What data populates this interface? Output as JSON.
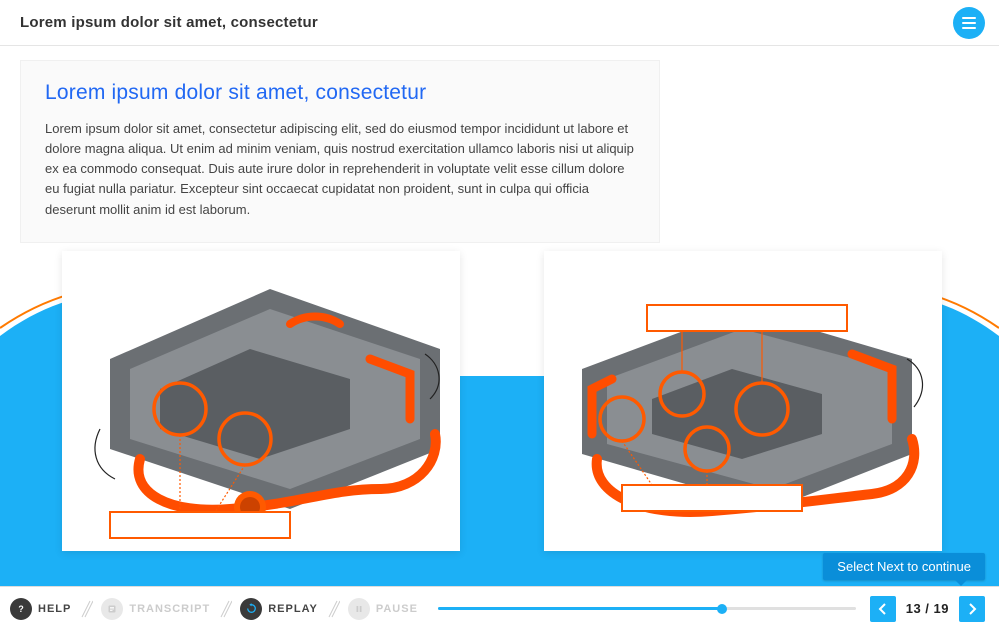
{
  "header": {
    "title": "Lorem ipsum dolor sit amet, consectetur"
  },
  "content": {
    "heading": "Lorem ipsum dolor sit amet, consectetur",
    "body": "Lorem ipsum dolor sit amet, consectetur adipiscing elit, sed do eiusmod tempor incididunt ut labore et dolore magna aliqua. Ut enim ad minim veniam, quis nostrud exercitation ullamco laboris nisi ut aliquip ex ea commodo consequat. Duis aute irure dolor in reprehenderit in voluptate velit esse cillum dolore eu fugiat nulla pariatur. Excepteur sint occaecat cupidatat non proident, sunt in culpa qui officia deserunt mollit anim id est laborum."
  },
  "hint": {
    "text": "Select Next to continue"
  },
  "footer": {
    "help": "HELP",
    "transcript": "TRANSCRIPT",
    "replay": "REPLAY",
    "pause": "PAUSE",
    "page_current": "13",
    "page_sep": " / ",
    "page_total": "19",
    "progress_percent": 68
  },
  "colors": {
    "accent": "#1cb0f6",
    "orange": "#ff5a00",
    "link": "#2168f3"
  }
}
